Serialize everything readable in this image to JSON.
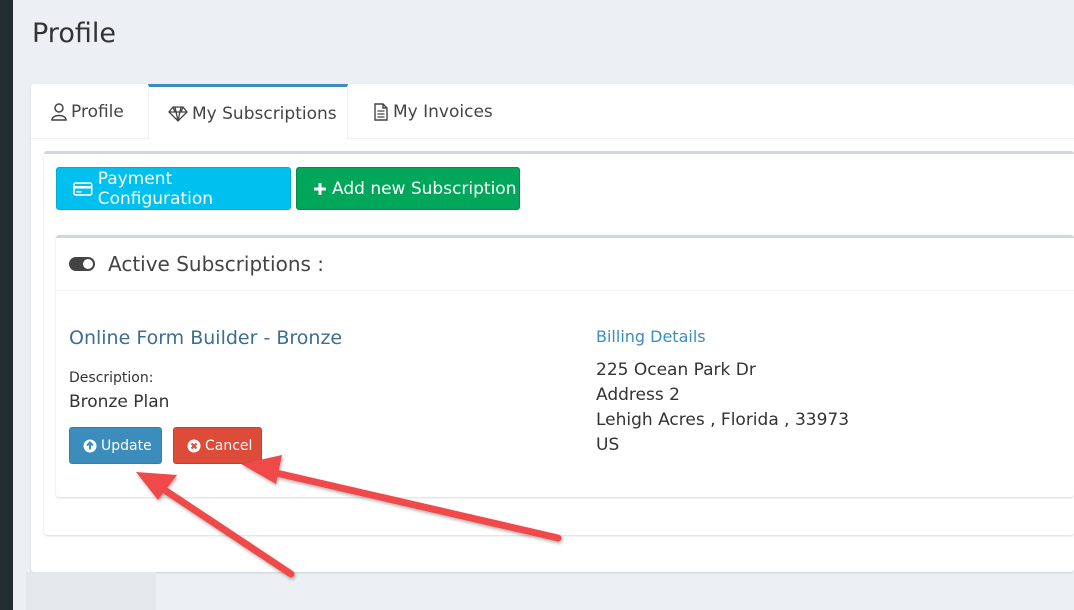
{
  "page": {
    "title": "Profile"
  },
  "tabs": [
    {
      "label": "Profile",
      "icon": "user-icon"
    },
    {
      "label": "My Subscriptions",
      "icon": "diamond-icon",
      "active": true
    },
    {
      "label": "My Invoices",
      "icon": "invoice-icon"
    }
  ],
  "toolbar": {
    "payment_label": "Payment Configuration",
    "add_label": "Add new Subscription"
  },
  "subscriptions": {
    "header": "Active Subscriptions :",
    "plan_name": "Online Form Builder - Bronze",
    "description_label": "Description:",
    "description_value": "Bronze Plan",
    "update_label": "Update",
    "cancel_label": "Cancel"
  },
  "billing": {
    "title": "Billing Details",
    "line1": "225 Ocean Park Dr",
    "line2": "Address 2",
    "line3": "Lehigh Acres , Florida , 33973",
    "line4": "US"
  },
  "colors": {
    "primary": "#3c8dbc",
    "info": "#00c0ef",
    "success": "#00a65a",
    "danger": "#dd4b39",
    "annotation_arrow": "#f04a4a"
  }
}
